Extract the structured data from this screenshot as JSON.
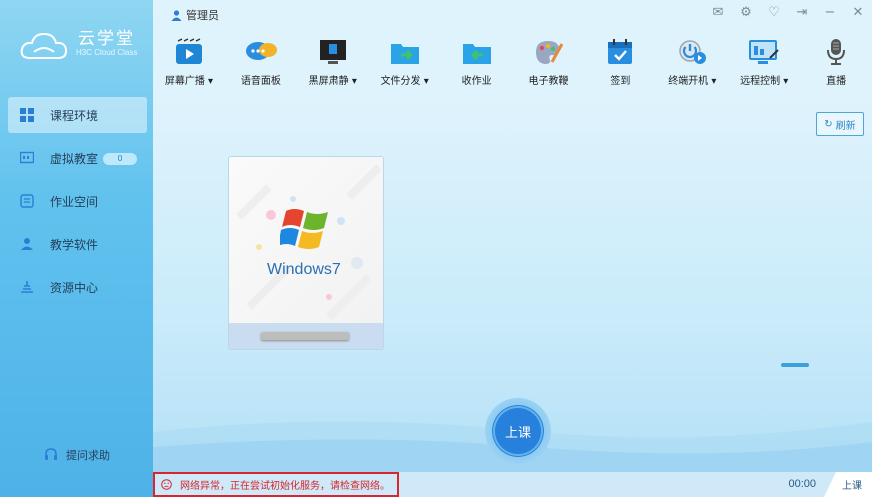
{
  "app": {
    "logo_title": "云学堂",
    "logo_subtitle": "H3C Cloud Class",
    "user": "管理员"
  },
  "window_controls": [
    {
      "name": "mail-icon",
      "glyph": "✉"
    },
    {
      "name": "settings-icon",
      "glyph": "⚙"
    },
    {
      "name": "skin-icon",
      "glyph": "♡"
    },
    {
      "name": "logout-icon",
      "glyph": "⇥"
    },
    {
      "name": "minimize-icon",
      "glyph": "−"
    },
    {
      "name": "close-icon",
      "glyph": "✕"
    }
  ],
  "toolbar": [
    {
      "label": "屏幕广播 ▾",
      "icon": "screen-broadcast-icon"
    },
    {
      "label": "语音面板",
      "icon": "voice-panel-icon"
    },
    {
      "label": "黑屏肃静 ▾",
      "icon": "black-screen-icon"
    },
    {
      "label": "文件分发 ▾",
      "icon": "file-distribute-icon"
    },
    {
      "label": "收作业",
      "icon": "collect-homework-icon"
    },
    {
      "label": "电子教鞭",
      "icon": "e-pointer-icon"
    },
    {
      "label": "签到",
      "icon": "sign-in-icon"
    },
    {
      "label": "终端开机 ▾",
      "icon": "terminal-power-icon"
    },
    {
      "label": "远程控制 ▾",
      "icon": "remote-control-icon"
    },
    {
      "label": "直播",
      "icon": "live-icon"
    }
  ],
  "sidebar": {
    "items": [
      {
        "label": "课程环境",
        "icon": "windows-grid-icon",
        "active": true
      },
      {
        "label": "虚拟教室",
        "icon": "classroom-icon",
        "badge": "0"
      },
      {
        "label": "作业空间",
        "icon": "homework-icon"
      },
      {
        "label": "教学软件",
        "icon": "software-icon"
      },
      {
        "label": "资源中心",
        "icon": "resource-icon"
      }
    ],
    "help_label": "提问求助"
  },
  "main": {
    "refresh_label": "刷新",
    "vm_name": "Windows7",
    "class_button_label": "上课"
  },
  "status": {
    "error_text": "网络异常，正在尝试初始化服务，请检查网络。",
    "timer": "00:00",
    "tab_label": "上课"
  },
  "colors": {
    "accent": "#2a88c6",
    "error": "#d7262d",
    "sidebar_top": "#8fd6f2",
    "sidebar_bottom": "#4eb2e8"
  }
}
